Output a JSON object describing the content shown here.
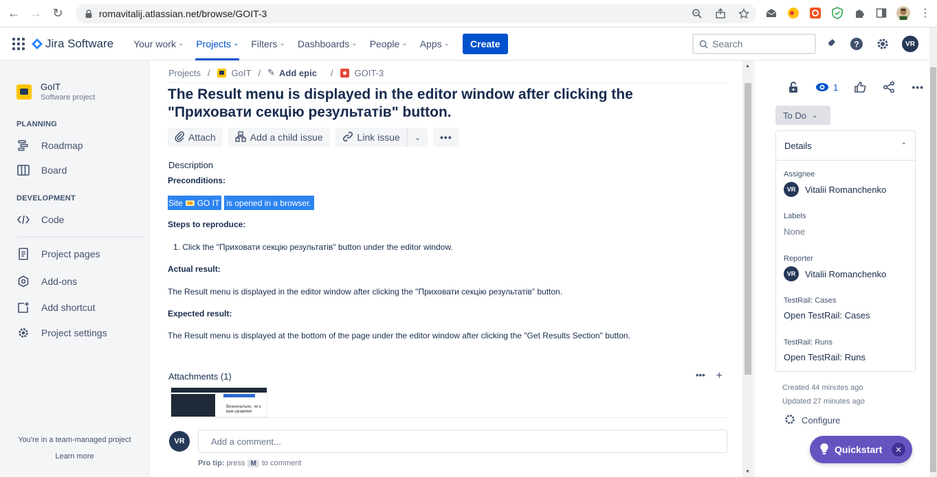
{
  "browser": {
    "url": "romavitalij.atlassian.net/browse/GOIT-3"
  },
  "nav": {
    "product": "Jira Software",
    "items": [
      {
        "label": "Your work"
      },
      {
        "label": "Projects"
      },
      {
        "label": "Filters"
      },
      {
        "label": "Dashboards"
      },
      {
        "label": "People"
      },
      {
        "label": "Apps"
      }
    ],
    "create_label": "Create",
    "search_placeholder": "Search",
    "user_initials": "VR"
  },
  "sidebar": {
    "project_name": "GoIT",
    "project_type": "Software project",
    "planning_label": "PLANNING",
    "roadmap": "Roadmap",
    "board": "Board",
    "development_label": "DEVELOPMENT",
    "code": "Code",
    "project_pages": "Project pages",
    "addons": "Add-ons",
    "add_shortcut": "Add shortcut",
    "project_settings": "Project settings",
    "team_note": "You're in a team-managed project",
    "learn_more": "Learn more"
  },
  "breadcrumb": {
    "projects": "Projects",
    "project": "GoIT",
    "epic": "Add epic",
    "issue_key": "GOIT-3"
  },
  "issue": {
    "title": "The Result menu is displayed in the editor window after clicking the \"Приховати секцію результатів\" button.",
    "actions": {
      "attach": "Attach",
      "add_child": "Add a child issue",
      "link_issue": "Link issue"
    },
    "description_label": "Description",
    "preconditions_label": "Preconditions:",
    "precondition_site": "Site",
    "precondition_goit": "GO IT",
    "precondition_rest": "is opened in a browser.",
    "steps_label": "Steps to reproduce:",
    "step_1": "1. Click the \"Приховати секцію результатів\" button under the editor window.",
    "actual_label": "Actual result:",
    "actual_text": "The Result menu is displayed in the editor window after clicking the \"Приховати секцію результатів\" button.",
    "expected_label": "Expected result:",
    "expected_text": "The Result menu is displayed at the bottom of the page under the editor window after clicking the \"Get Results Section\" button.",
    "attachments_label": "Attachments (1)",
    "thumbnail_text": "Визначально, чи є вам цікавими",
    "comment_avatar": "VR",
    "comment_placeholder": "Add a comment...",
    "protip_label": "Pro tip:",
    "protip_press": "press",
    "protip_key": "M",
    "protip_rest": "to comment"
  },
  "panel": {
    "watchers_count": "1",
    "status": "To Do",
    "details_label": "Details",
    "assignee_label": "Assignee",
    "assignee_initials": "VR",
    "assignee": "Vitalii Romanchenko",
    "labels_label": "Labels",
    "labels_value": "None",
    "reporter_label": "Reporter",
    "reporter_initials": "VR",
    "reporter": "Vitalii Romanchenko",
    "testrail_cases_label": "TestRail: Cases",
    "testrail_cases_link": "Open TestRail: Cases",
    "testrail_runs_label": "TestRail: Runs",
    "testrail_runs_link": "Open TestRail: Runs",
    "created": "Created 44 minutes ago",
    "updated": "Updated 27 minutes ago",
    "configure": "Configure"
  },
  "quickstart": {
    "label": "Quickstart"
  },
  "colors": {
    "primary": "#0052cc",
    "quickstart": "#6554c0",
    "highlight": "#2d84f1"
  }
}
